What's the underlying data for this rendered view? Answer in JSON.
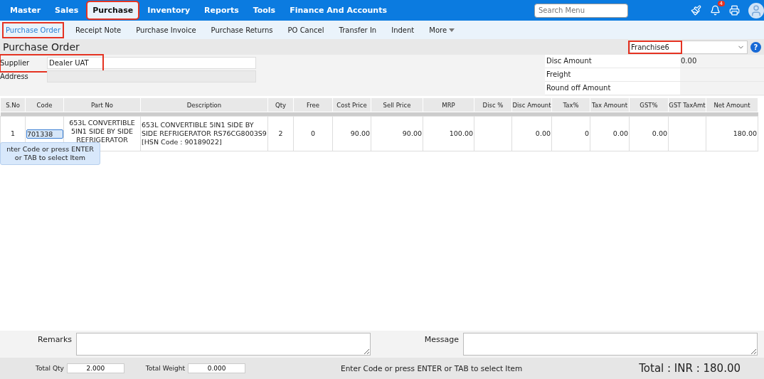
{
  "top_menu": [
    {
      "label": "Master",
      "selected": false,
      "highlighted": false
    },
    {
      "label": "Sales",
      "selected": false,
      "highlighted": false
    },
    {
      "label": "Purchase",
      "selected": true,
      "highlighted": true
    },
    {
      "label": "Inventory",
      "selected": false,
      "highlighted": false
    },
    {
      "label": "Reports",
      "selected": false,
      "highlighted": false
    },
    {
      "label": "Tools",
      "selected": false,
      "highlighted": false
    },
    {
      "label": "Finance And Accounts",
      "selected": false,
      "highlighted": false
    }
  ],
  "search": {
    "placeholder": "Search Menu"
  },
  "notifications": {
    "badge": "4"
  },
  "sub_menu": [
    {
      "label": "Purchase Order",
      "selected": true,
      "highlighted": true
    },
    {
      "label": "Receipt Note",
      "selected": false,
      "highlighted": false
    },
    {
      "label": "Purchase Invoice",
      "selected": false,
      "highlighted": false
    },
    {
      "label": "Purchase Returns",
      "selected": false,
      "highlighted": false
    },
    {
      "label": "PO Cancel",
      "selected": false,
      "highlighted": false
    },
    {
      "label": "Transfer In",
      "selected": false,
      "highlighted": false
    },
    {
      "label": "Indent",
      "selected": false,
      "highlighted": false
    },
    {
      "label": "More",
      "selected": false,
      "highlighted": false
    }
  ],
  "page_title": "Purchase Order",
  "branch_select": {
    "value": "Franchise6",
    "highlighted": true
  },
  "help": {
    "label": "?"
  },
  "supplier": {
    "label": "Supplier",
    "value": "Dealer UAT",
    "highlighted": true
  },
  "address": {
    "label": "Address"
  },
  "summary": [
    {
      "label": "Disc Amount",
      "value": "0.00"
    },
    {
      "label": "Freight"
    },
    {
      "label": "Round off Amount"
    }
  ],
  "table": {
    "columns": [
      "S.No",
      "Code",
      "Part No",
      "Description",
      "Qty",
      "Free",
      "Cost Price",
      "Sell Price",
      "MRP",
      "Disc %",
      "Disc Amount",
      "Tax%",
      "Tax Amount",
      "GST%",
      "GST TaxAmt",
      "Net Amount"
    ],
    "rows": [
      {
        "sno": "1",
        "code": "701338",
        "part_no": "653L CONVERTIBLE 5IN1 SIDE BY SIDE REFRIGERATOR",
        "description": "653L CONVERTIBLE 5IN1 SIDE BY SIDE REFRIGERATOR RS76CG8003S9",
        "hsn": "[HSN Code : 90189022]",
        "qty": "2",
        "free": "0",
        "cost_price": "90.00",
        "sell_price": "90.00",
        "mrp": "100.00",
        "disc_amount": "0.00",
        "tax_pct": "0",
        "tax_amount": "0.00",
        "gst_pct": "0.00",
        "net_amount": "180.00"
      }
    ]
  },
  "tooltip": "nter Code or press ENTER or TAB to select Item",
  "remarks": {
    "label": "Remarks"
  },
  "message": {
    "label": "Message"
  },
  "footer": {
    "total_qty_label": "Total Qty",
    "total_qty": "2.000",
    "total_weight_label": "Total Weight",
    "total_weight": "0.000",
    "hint": "Enter Code or press ENTER or TAB to select Item",
    "total": "Total : INR : 180.00"
  }
}
